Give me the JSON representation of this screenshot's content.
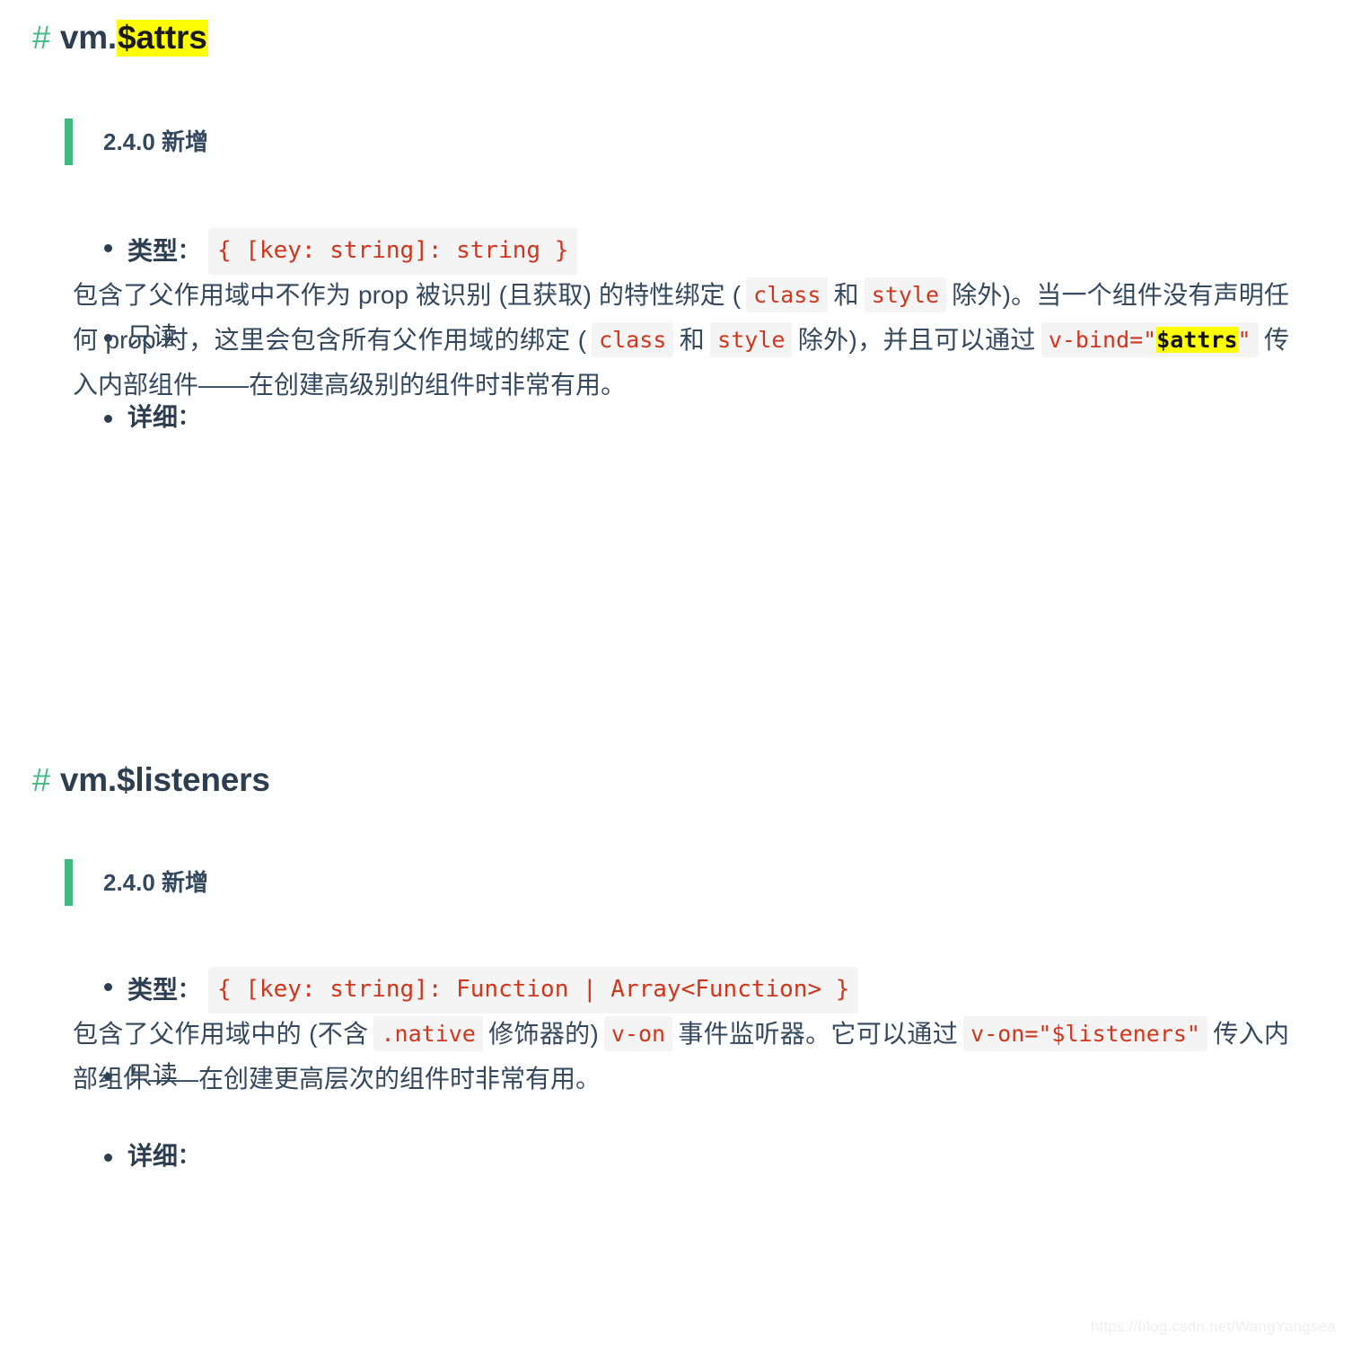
{
  "watermark": "https://blog.csdn.net/WangYangsea",
  "colors": {
    "anchor_green": "#42b983",
    "heading_text": "#2c3e50",
    "code_red": "#d1351b",
    "code_bg": "#f4f4f4",
    "highlight_yellow": "#ffff00",
    "body_text": "#34495e"
  },
  "sections": [
    {
      "id": "attrs",
      "anchor": "#",
      "heading_prefix": "vm.",
      "heading_highlight": "$attrs",
      "blockquote": "2.4.0 新增",
      "items": [
        {
          "label": "类型",
          "colon": "：",
          "bold": true,
          "code": "{ [key: string]: string }"
        },
        {
          "label": "只读",
          "colon": "",
          "bold": false,
          "code": ""
        },
        {
          "label": "详细",
          "colon": "：",
          "bold": true,
          "code": ""
        }
      ],
      "detail_paragraph": {
        "part1": "包含了父作用域中不作为 prop 被识别 (且获取) 的特性绑定 (",
        "code1": "class",
        "part2": "和",
        "code2": "style",
        "part3": "除外)。当一个组件没有声明任何 prop 时，这里会包含所有父作用域的绑定 (",
        "code3": "class",
        "part4": "和",
        "code4": "style",
        "part5": "除外)，并且可以通过",
        "code5_prefix": "v-bind=\"",
        "code5_highlight": "$attrs",
        "code5_suffix": "\"",
        "part6": "传入内部组件——在创建高级别的组件时非常有用。"
      }
    },
    {
      "id": "listeners",
      "anchor": "#",
      "heading_prefix": "vm.$listeners",
      "heading_highlight": "",
      "blockquote": "2.4.0 新增",
      "items": [
        {
          "label": "类型",
          "colon": "：",
          "bold": true,
          "code": "{ [key: string]: Function | Array<Function> }"
        },
        {
          "label": "只读",
          "colon": "",
          "bold": false,
          "code": ""
        },
        {
          "label": "详细",
          "colon": "：",
          "bold": true,
          "code": ""
        }
      ],
      "detail_paragraph": {
        "part1": "包含了父作用域中的 (不含",
        "code1": ".native",
        "part2": "修饰器的)",
        "code2": "v-on",
        "part3": "事件监听器。它可以通过",
        "code3": "v-on=\"$listeners\"",
        "part4": "传入内部组件——在创建更高层次的组件时非常有用。"
      }
    }
  ]
}
